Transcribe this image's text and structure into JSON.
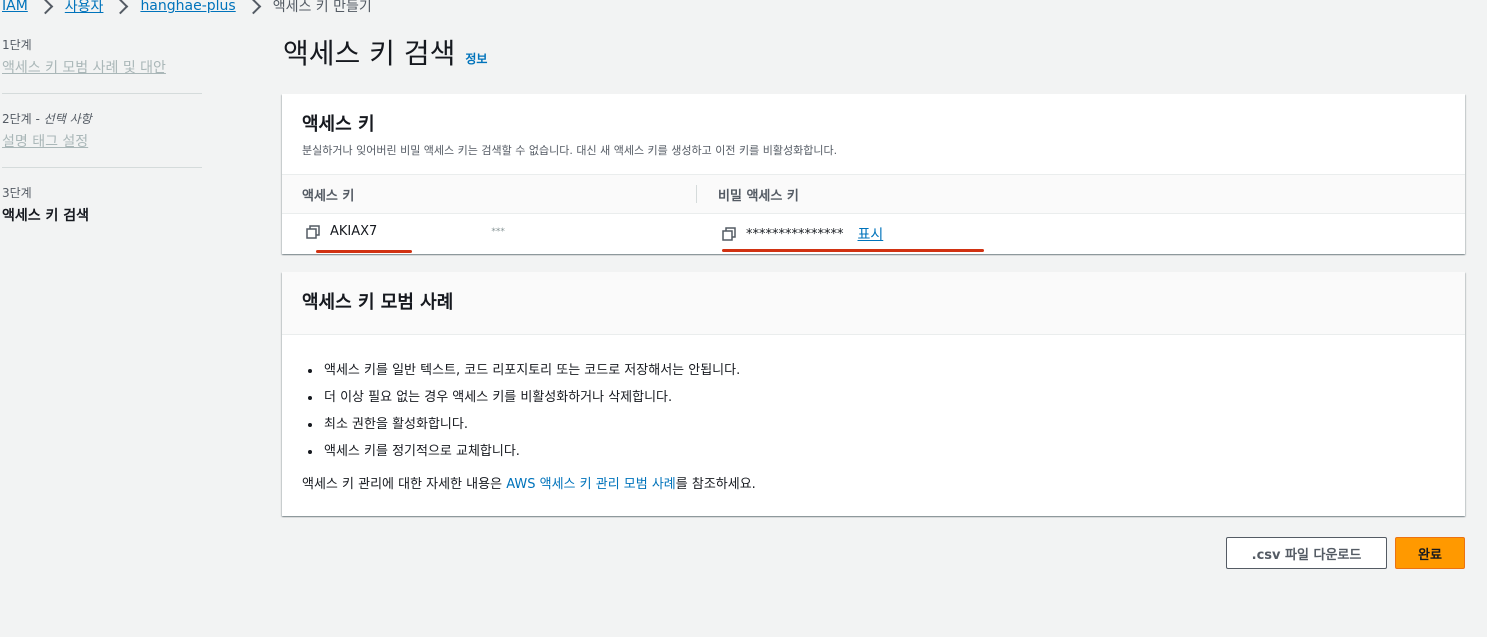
{
  "breadcrumb": {
    "items": [
      "IAM",
      "사용자",
      "hanghae-plus"
    ],
    "current": "액세스 키 만들기"
  },
  "sidebar": {
    "steps": [
      {
        "num": "1단계",
        "title": "액세스 키 모범 사례 및 대안"
      },
      {
        "num": "2단계",
        "suffix": " - 선택 사항",
        "title": "설명 태그 설정"
      },
      {
        "num": "3단계",
        "title": "액세스 키 검색"
      }
    ]
  },
  "header": {
    "title": "액세스 키 검색",
    "info": "정보"
  },
  "access_panel": {
    "title": "액세스 키",
    "description": "분실하거나 잊어버린 비밀 액세스 키는 검색할 수 없습니다. 대신 새 액세스 키를 생성하고 이전 키를 비활성화합니다.",
    "col_access_key": "액세스 키",
    "col_secret_key": "비밀 액세스 키",
    "access_key_value": "AKIAX7",
    "access_key_tail": "***",
    "secret_key_value": "***************",
    "reveal_label": "표시",
    "highlight_color": "#d13212"
  },
  "best_practices": {
    "title": "액세스 키 모범 사례",
    "items": [
      "액세스 키를 일반 텍스트, 코드 리포지토리 또는 코드로 저장해서는 안됩니다.",
      "더 이상 필요 없는 경우 액세스 키를 비활성화하거나 삭제합니다.",
      "최소 권한을 활성화합니다.",
      "액세스 키를 정기적으로 교체합니다."
    ],
    "note_prefix": "액세스 키 관리에 대한 자세한 내용은 ",
    "note_link": "AWS 액세스 키 관리 모범 사례",
    "note_suffix": "를 참조하세요."
  },
  "actions": {
    "download_csv": ".csv 파일 다운로드",
    "done": "완료",
    "accent": "#ff9900"
  }
}
